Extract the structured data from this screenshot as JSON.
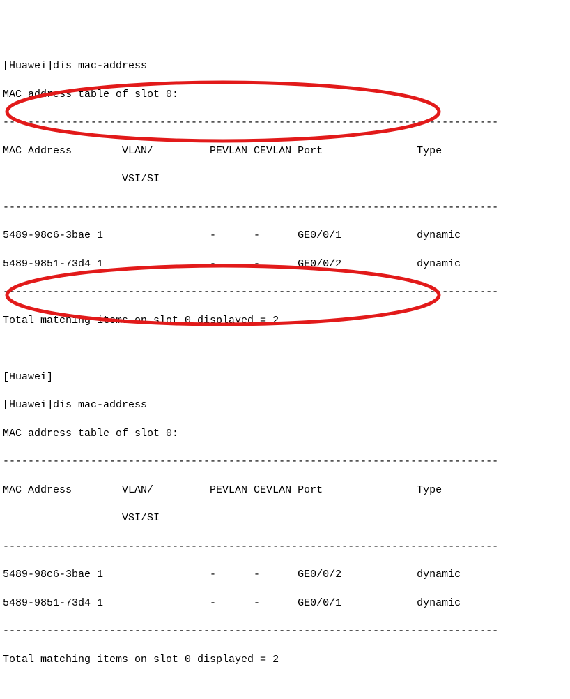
{
  "block1": {
    "prompt_line": "[Huawei]dis mac-address",
    "title_line": "MAC address table of slot 0:",
    "dashes": "-------------------------------------------------------------------------------",
    "header_line1": "MAC Address        VLAN/         PEVLAN CEVLAN Port               Type   ",
    "header_line2": "                   VSI/SI                                                     ",
    "rows": [
      "5489-98c6-3bae 1                 -      -      GE0/0/1            dynamic",
      "5489-9851-73d4 1                 -      -      GE0/0/2            dynamic"
    ],
    "footer": "Total matching items on slot 0 displayed = 2"
  },
  "between": {
    "prompt_blank": "[Huawei]",
    "prompt_line": "[Huawei]dis mac-address",
    "title_line": "MAC address table of slot 0:"
  },
  "block2": {
    "dashes": "-------------------------------------------------------------------------------",
    "header_line1": "MAC Address        VLAN/         PEVLAN CEVLAN Port               Type   ",
    "header_line2": "                   VSI/SI                                                     ",
    "rows": [
      "5489-98c6-3bae 1                 -      -      GE0/0/2            dynamic",
      "5489-9851-73d4 1                 -      -      GE0/0/1            dynamic"
    ],
    "footer": "Total matching items on slot 0 displayed = 2"
  },
  "chart_data": {
    "type": "table",
    "title": "MAC address table of slot 0",
    "columns": [
      "MAC Address",
      "VLAN/VSI/SI",
      "PEVLAN",
      "CEVLAN",
      "Port",
      "Type"
    ],
    "tables": [
      {
        "rows": [
          [
            "5489-98c6-3bae",
            "1",
            "-",
            "-",
            "GE0/0/1",
            "dynamic"
          ],
          [
            "5489-9851-73d4",
            "1",
            "-",
            "-",
            "GE0/0/2",
            "dynamic"
          ]
        ],
        "total_matching": 2
      },
      {
        "rows": [
          [
            "5489-98c6-3bae",
            "1",
            "-",
            "-",
            "GE0/0/2",
            "dynamic"
          ],
          [
            "5489-9851-73d4",
            "1",
            "-",
            "-",
            "GE0/0/1",
            "dynamic"
          ]
        ],
        "total_matching": 2
      }
    ]
  }
}
